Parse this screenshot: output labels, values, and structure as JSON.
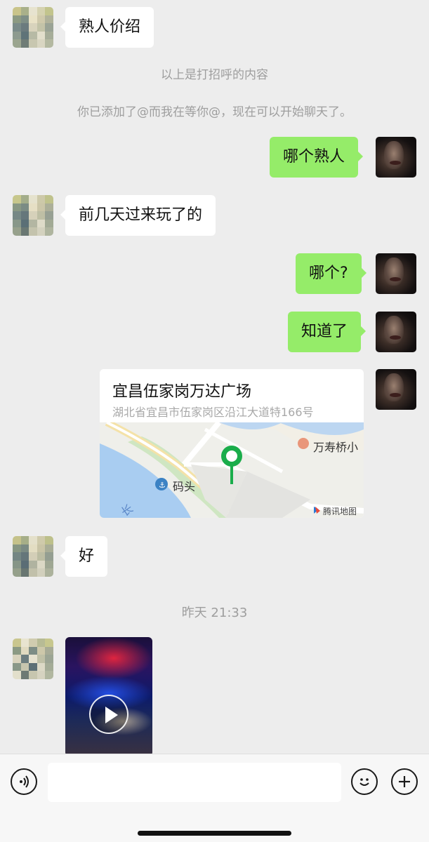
{
  "messages": {
    "m1": "熟人价绍",
    "sys1": "以上是打招呼的内容",
    "sys2": "你已添加了@而我在等你@，现在可以开始聊天了。",
    "m2": "哪个熟人",
    "m3": "前几天过来玩了的",
    "m4": "哪个?",
    "m5": "知道了",
    "m6": "好",
    "timestamp": "昨天 21:33"
  },
  "location": {
    "title": "宜昌伍家岗万达广场",
    "address": "湖北省宜昌市伍家岗区沿江大道特166号",
    "map_labels": {
      "poi": "万寿桥小",
      "dock": "码头",
      "river": "长",
      "credit": "腾讯地图"
    }
  },
  "input": {
    "value": "",
    "placeholder": ""
  },
  "icons": {
    "voice": "voice-icon",
    "emoji": "emoji-icon",
    "add": "plus-icon",
    "play": "play-icon",
    "pin": "location-pin-icon"
  },
  "colors": {
    "background": "#ededed",
    "outgoing_bubble": "#95ec69",
    "incoming_bubble": "#ffffff",
    "system_text": "#9e9e9e",
    "pin": "#1aad4b"
  }
}
